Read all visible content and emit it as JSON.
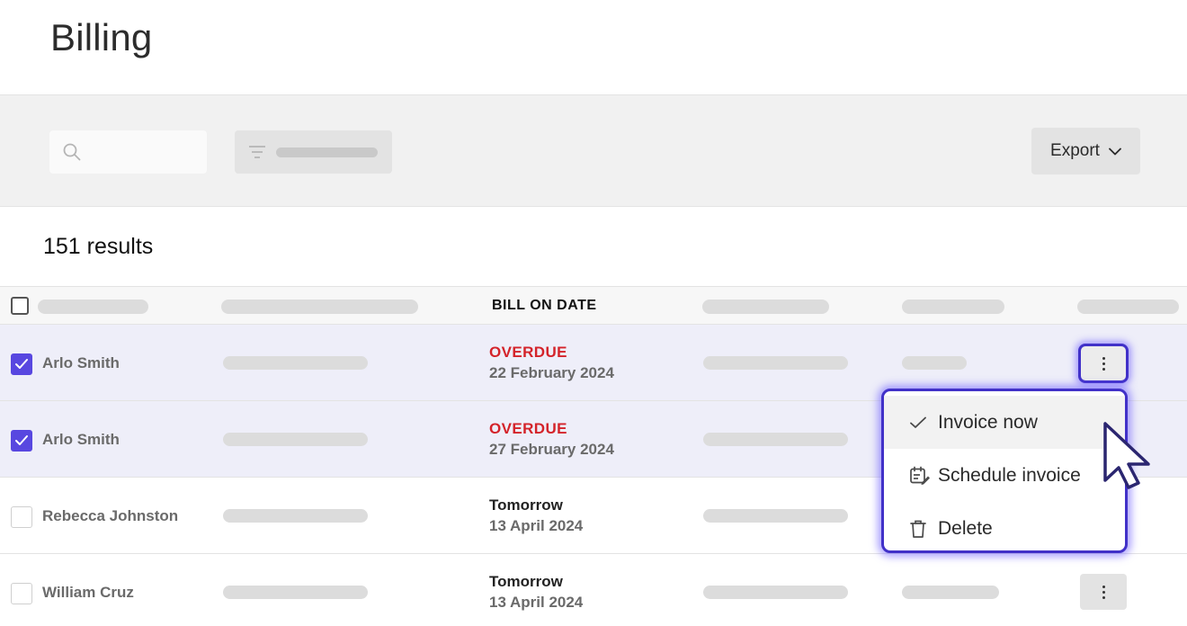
{
  "page": {
    "title": "Billing"
  },
  "toolbar": {
    "search_icon": "search-icon",
    "filter_icon": "filter-icon",
    "export_label": "Export",
    "export_icon": "chevron-down-icon"
  },
  "results": {
    "label": "151 results"
  },
  "table": {
    "bill_on_date_header": "BILL ON DATE",
    "rows": [
      {
        "name": "Arlo Smith",
        "status": "OVERDUE",
        "date": "22 February 2024",
        "checked": true,
        "overdue": true
      },
      {
        "name": "Arlo Smith",
        "status": "OVERDUE",
        "date": "27 February 2024",
        "checked": true,
        "overdue": true
      },
      {
        "name": "Rebecca Johnston",
        "status": "Tomorrow",
        "date": "13 April 2024",
        "checked": false,
        "overdue": false
      },
      {
        "name": "William Cruz",
        "status": "Tomorrow",
        "date": "13 April 2024",
        "checked": false,
        "overdue": false
      }
    ]
  },
  "context_menu": {
    "items": [
      {
        "label": "Invoice now",
        "icon": "check-icon"
      },
      {
        "label": "Schedule invoice",
        "icon": "calendar-edit-icon"
      },
      {
        "label": "Delete",
        "icon": "trash-icon"
      }
    ]
  },
  "colors": {
    "accent": "#5847e0",
    "focus_ring": "#4131c8",
    "overdue": "#d4232a",
    "selected_row": "#eeeef9"
  }
}
